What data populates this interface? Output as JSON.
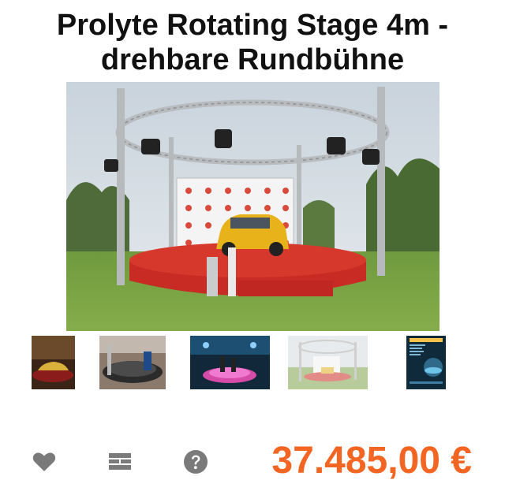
{
  "product": {
    "title_line1": "Prolyte Rotating Stage 4m -",
    "title_line2": "drehbare Rundbühne",
    "price": "37.485,00 €",
    "main_image_icon": "rotating-stage-photo"
  },
  "thumbnails": [
    {
      "icon": "stage-car-photo",
      "selected": false
    },
    {
      "icon": "stage-construction-photo",
      "selected": false
    },
    {
      "icon": "stage-concert-photo",
      "selected": false
    },
    {
      "icon": "stage-outdoor-photo",
      "selected": true
    },
    {
      "icon": "rotating-stage-brochure",
      "selected": false
    }
  ],
  "actions": [
    {
      "icon": "heart-icon",
      "label": "wishlist"
    },
    {
      "icon": "compare-icon",
      "label": "compare"
    },
    {
      "icon": "question-icon",
      "label": "question"
    }
  ],
  "colors": {
    "price": "#f26522",
    "icon": "#7a7a7a",
    "title": "#111111"
  }
}
